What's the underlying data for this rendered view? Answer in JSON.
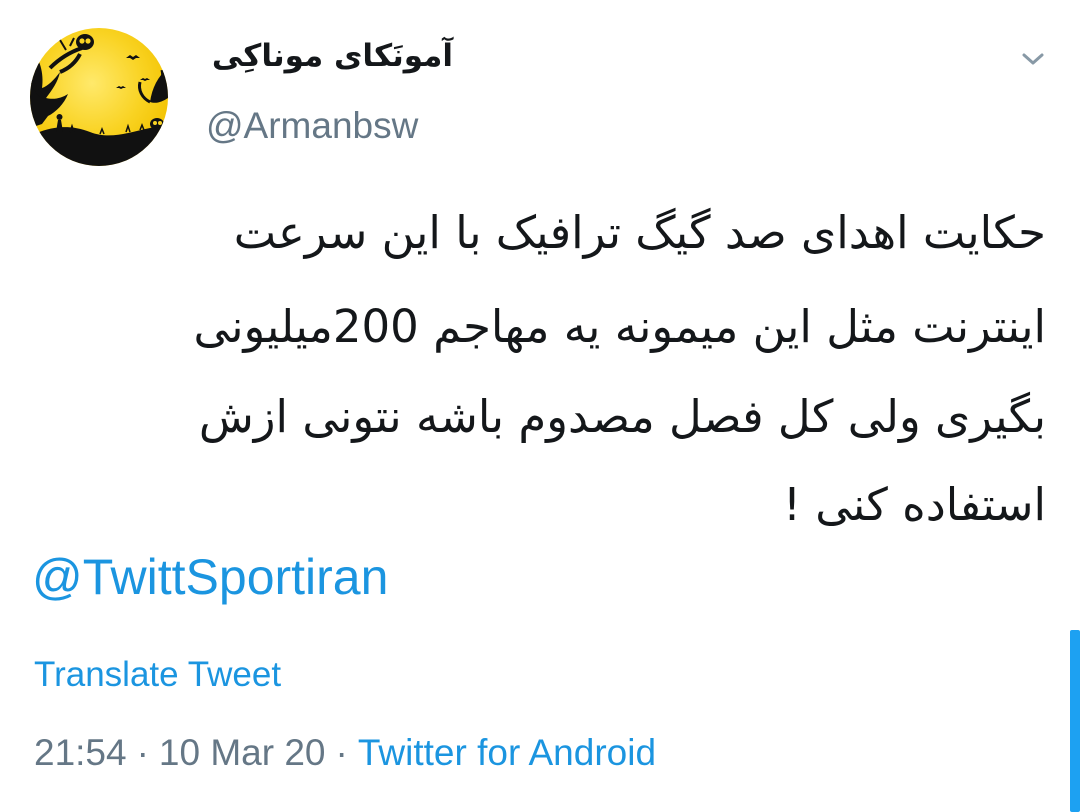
{
  "user": {
    "display_name": "آمونَکای موناکِی",
    "handle": "@Armanbsw",
    "avatar": "avatar-halloween-moon-icon"
  },
  "menu_icon": "chevron-down-icon",
  "tweet": {
    "lines": [
      "حکایت اهدای صد گیگ ترافیک با این سرعت",
      "اینترنت مثل این میمونه یه مهاجم 200میلیونی",
      "بگیری ولی کل فصل مصدوم باشه نتونی ازش",
      "استفاده کنی !"
    ],
    "mention": "@TwittSportiran",
    "translate_label": "Translate Tweet"
  },
  "meta": {
    "time": "21:54",
    "date": "10 Mar 20",
    "separator": "·",
    "source": "Twitter for Android"
  },
  "colors": {
    "link": "#1b95e0",
    "secondary": "#657786",
    "text": "#14171a",
    "avatar_yellow": "#f9d323"
  }
}
